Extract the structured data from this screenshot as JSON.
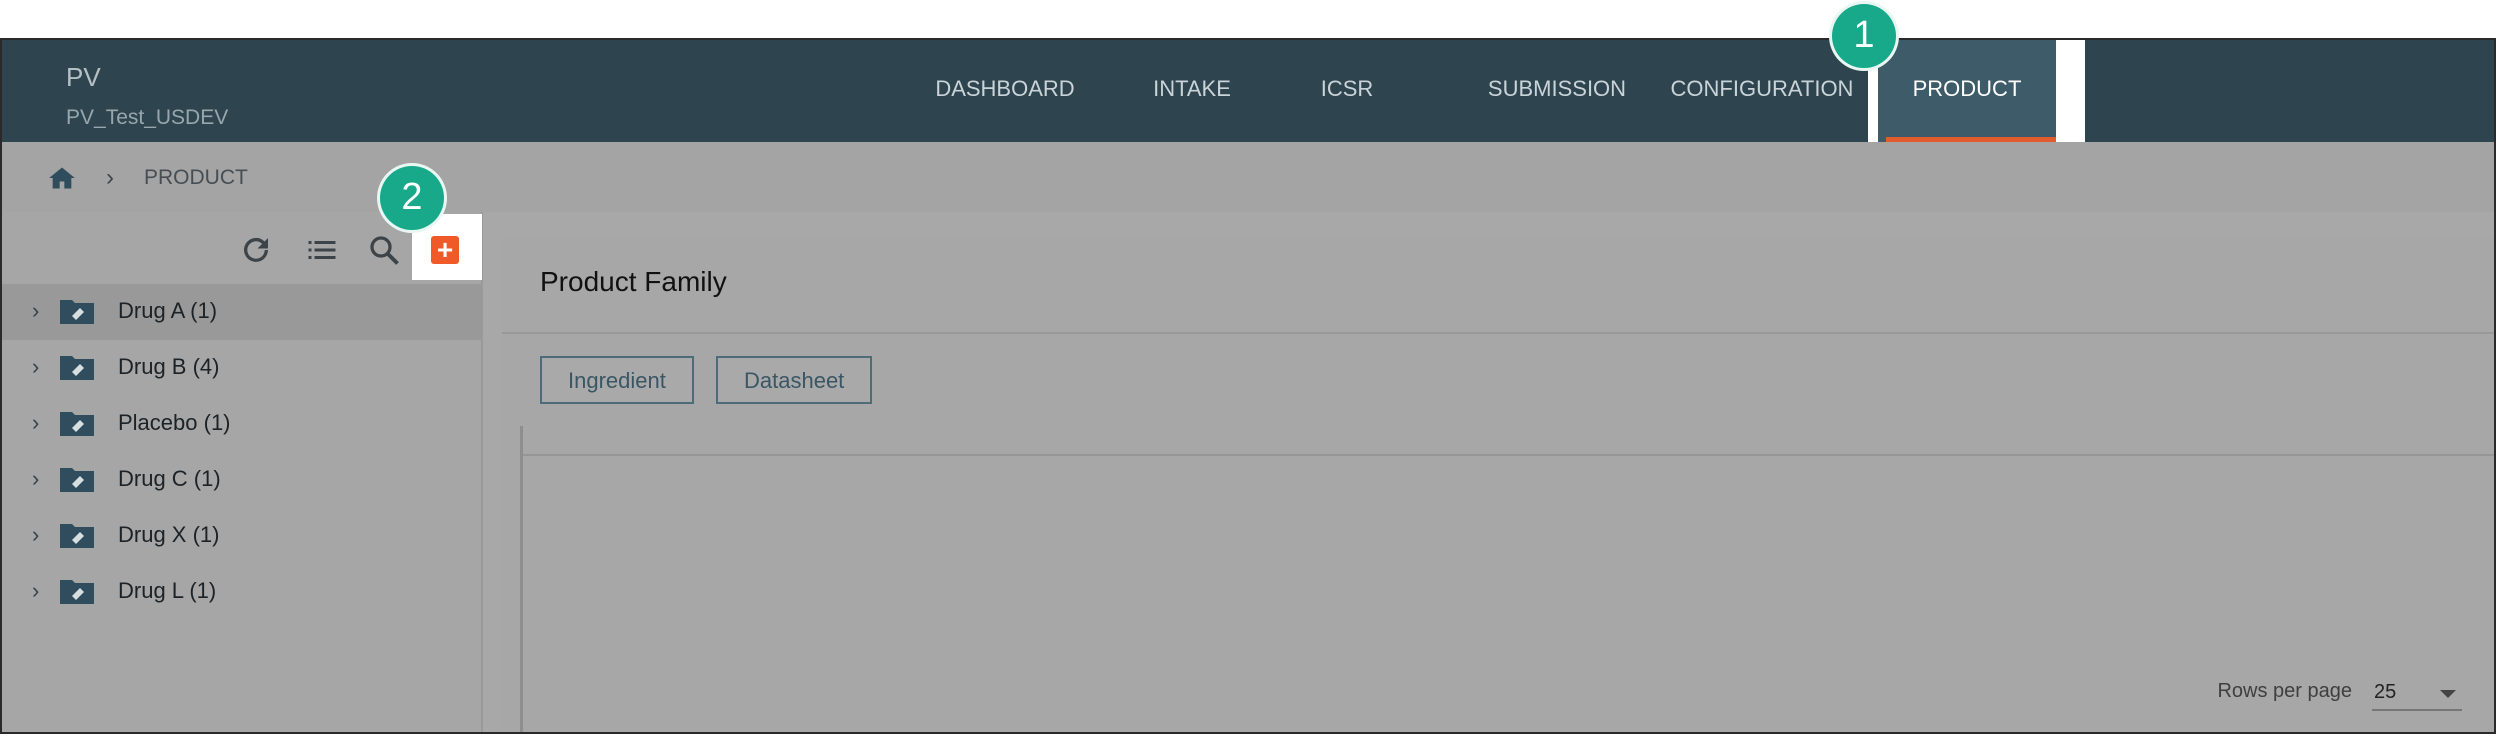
{
  "header": {
    "app_name": "PV",
    "environment": "PV_Test_USDEV",
    "nav": [
      "DASHBOARD",
      "INTAKE",
      "ICSR",
      "SUBMISSION",
      "CONFIGURATION"
    ],
    "active_nav": "PRODUCT"
  },
  "breadcrumb": {
    "current": "PRODUCT"
  },
  "tree": {
    "items": [
      "Drug A (1)",
      "Drug B (4)",
      "Placebo (1)",
      "Drug C (1)",
      "Drug X (1)",
      "Drug L (1)"
    ]
  },
  "main": {
    "title": "Product Family",
    "tabs": [
      "Ingredient",
      "Datasheet"
    ],
    "rows_per_page_label": "Rows per page",
    "rows_per_page_value": "25"
  },
  "callouts": [
    "1",
    "2"
  ],
  "colors": {
    "header_bg": "#2e4550",
    "accent": "#e25b2d",
    "add_button": "#f05a28",
    "callout": "#17a98a"
  }
}
